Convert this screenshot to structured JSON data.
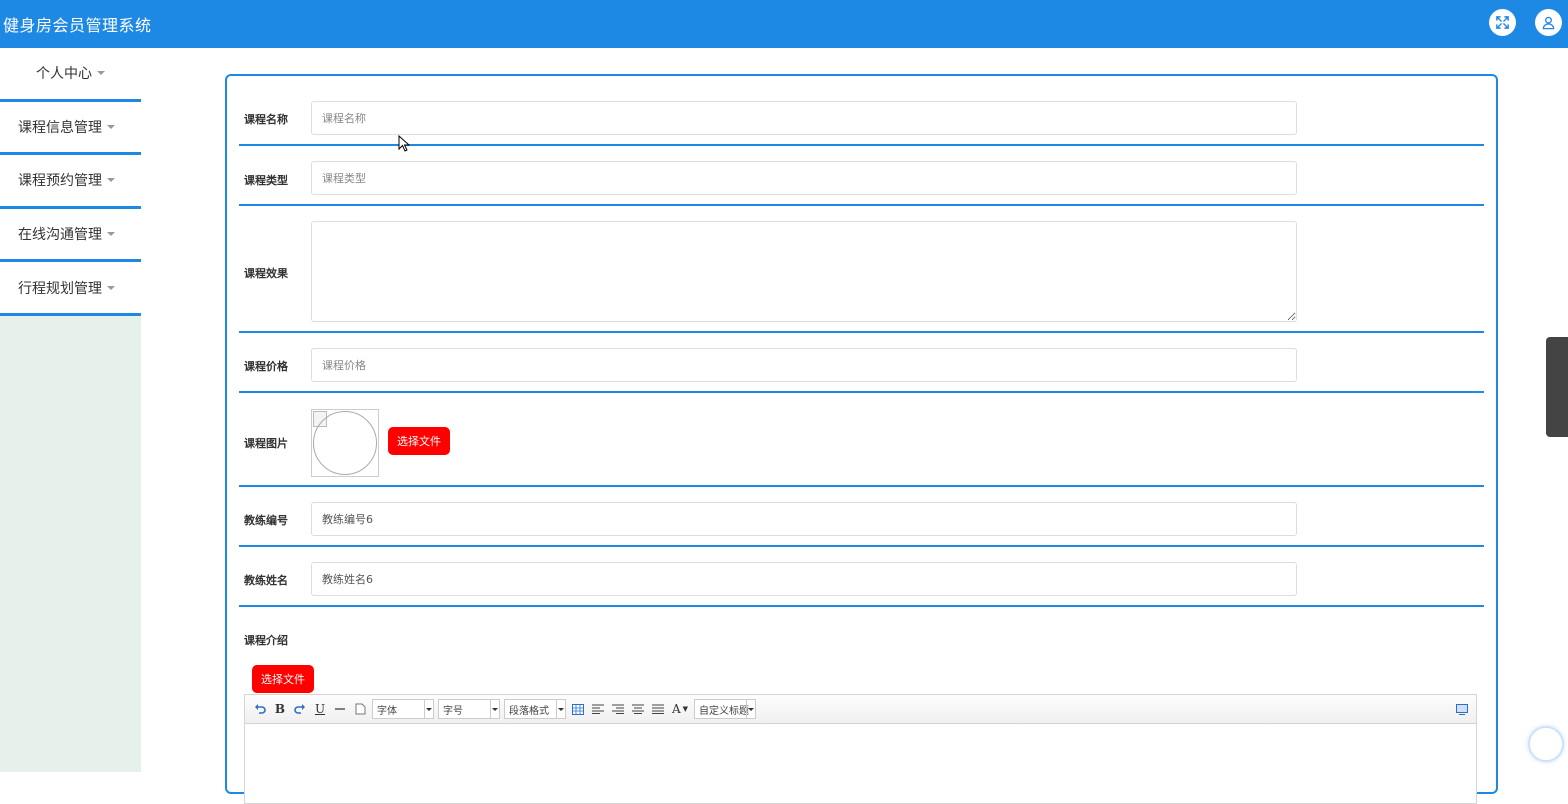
{
  "app": {
    "title": "健身房会员管理系统"
  },
  "header": {
    "fullscreen_icon": "expand-icon",
    "user_icon": "user-icon"
  },
  "sidebar": {
    "items": [
      {
        "label": "个人中心"
      },
      {
        "label": "课程信息管理"
      },
      {
        "label": "课程预约管理"
      },
      {
        "label": "在线沟通管理"
      },
      {
        "label": "行程规划管理"
      }
    ]
  },
  "form": {
    "course_name": {
      "label": "课程名称",
      "placeholder": "课程名称",
      "value": ""
    },
    "course_type": {
      "label": "课程类型",
      "placeholder": "课程类型",
      "value": ""
    },
    "course_effect": {
      "label": "课程效果",
      "value": ""
    },
    "course_price": {
      "label": "课程价格",
      "placeholder": "课程价格",
      "value": ""
    },
    "course_image": {
      "label": "课程图片",
      "button": "选择文件"
    },
    "coach_id": {
      "label": "教练编号",
      "value": "教练编号6"
    },
    "coach_name": {
      "label": "教练姓名",
      "value": "教练姓名6"
    },
    "course_intro": {
      "label": "课程介绍",
      "button": "选择文件"
    }
  },
  "editor": {
    "toolbar": {
      "font_family": "字体",
      "font_size": "字号",
      "paragraph": "段落格式",
      "custom_title": "自定义标题",
      "bold": "B",
      "underline": "U",
      "font_color": "A"
    }
  },
  "colors": {
    "primary": "#1e88e5",
    "danger": "#ff0000",
    "sidebar_bg": "#e6f1eb"
  }
}
